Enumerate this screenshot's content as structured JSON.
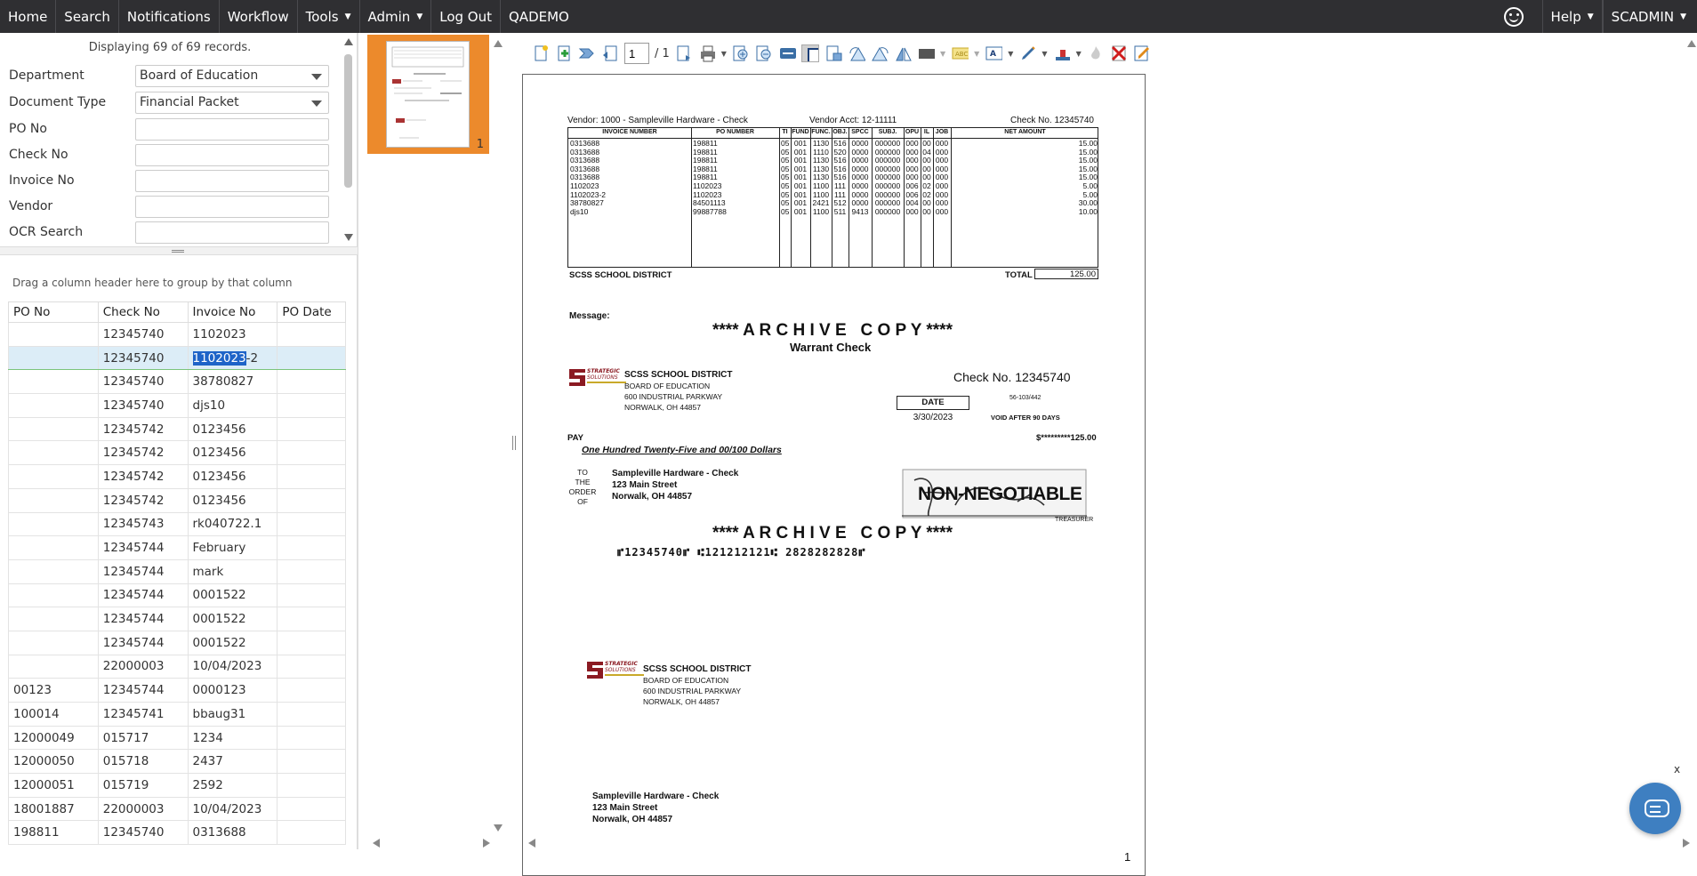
{
  "nav": {
    "items": [
      {
        "label": "Home",
        "caret": false
      },
      {
        "label": "Search",
        "caret": false
      },
      {
        "label": "Notifications",
        "caret": false
      },
      {
        "label": "Workflow",
        "caret": false
      },
      {
        "label": "Tools",
        "caret": true
      },
      {
        "label": "Admin",
        "caret": true
      },
      {
        "label": "Log Out",
        "caret": false
      },
      {
        "label": "QADEMO",
        "caret": false
      }
    ],
    "help": "Help",
    "user": "SCADMIN"
  },
  "search": {
    "displaying": "Displaying 69 of 69 records.",
    "department_label": "Department",
    "department_value": "Board of Education",
    "doctype_label": "Document Type",
    "doctype_value": "Financial Packet",
    "po_label": "PO No",
    "check_label": "Check No",
    "invoice_label": "Invoice No",
    "vendor_label": "Vendor",
    "ocr_label": "OCR Search"
  },
  "grid": {
    "group_hint": "Drag a column header here to group by that column",
    "columns": [
      "PO No",
      "Check No",
      "Invoice No",
      "PO Date"
    ],
    "rows": [
      [
        "",
        "12345740",
        "1102023",
        ""
      ],
      [
        "",
        "12345740",
        "1102023-2",
        ""
      ],
      [
        "",
        "12345740",
        "38780827",
        ""
      ],
      [
        "",
        "12345740",
        "djs10",
        ""
      ],
      [
        "",
        "12345742",
        "0123456",
        ""
      ],
      [
        "",
        "12345742",
        "0123456",
        ""
      ],
      [
        "",
        "12345742",
        "0123456",
        ""
      ],
      [
        "",
        "12345742",
        "0123456",
        ""
      ],
      [
        "",
        "12345743",
        "rk040722.1",
        ""
      ],
      [
        "",
        "12345744",
        "February",
        ""
      ],
      [
        "",
        "12345744",
        "mark",
        ""
      ],
      [
        "",
        "12345744",
        "0001522",
        ""
      ],
      [
        "",
        "12345744",
        "0001522",
        ""
      ],
      [
        "",
        "12345744",
        "0001522",
        ""
      ],
      [
        "",
        "22000003",
        "10/04/2023",
        ""
      ],
      [
        "00123",
        "12345744",
        "0000123",
        ""
      ],
      [
        "100014",
        "12345741",
        "bbaug31",
        ""
      ],
      [
        "12000049",
        "015717",
        "1234",
        ""
      ],
      [
        "12000050",
        "015718",
        "2437",
        ""
      ],
      [
        "12000051",
        "015719",
        "2592",
        ""
      ],
      [
        "18001887",
        "22000003",
        "10/04/2023",
        ""
      ],
      [
        "198811",
        "12345740",
        "0313688",
        ""
      ]
    ],
    "selected_row": 1,
    "selected_highlight": "1102023",
    "selected_rest": "-2"
  },
  "thumb": {
    "page_number": "1"
  },
  "viewer": {
    "page_input": "1",
    "page_total": "/ 1",
    "page_footer": "1"
  },
  "doc": {
    "vendor_line": "Vendor:  1000 - Sampleville Hardware - Check",
    "vendor_acct": "Vendor Acct:  12-11111",
    "check_no_top": "Check No.  12345740",
    "headers": [
      "INVOICE NUMBER",
      "PO NUMBER",
      "TI",
      "FUND",
      "FUNC.",
      "OBJ.",
      "SPCC",
      "SUBJ.",
      "OPU",
      "IL",
      "JOB",
      "NET AMOUNT"
    ],
    "lines": [
      [
        "0313688",
        "198811",
        "05",
        "001",
        "1130",
        "516",
        "0000",
        "000000",
        "000",
        "00",
        "000",
        "15.00"
      ],
      [
        "0313688",
        "198811",
        "05",
        "001",
        "1110",
        "520",
        "0000",
        "000000",
        "000",
        "04",
        "000",
        "15.00"
      ],
      [
        "0313688",
        "198811",
        "05",
        "001",
        "1130",
        "516",
        "0000",
        "000000",
        "000",
        "00",
        "000",
        "15.00"
      ],
      [
        "0313688",
        "198811",
        "05",
        "001",
        "1130",
        "516",
        "0000",
        "000000",
        "000",
        "00",
        "000",
        "15.00"
      ],
      [
        "0313688",
        "198811",
        "05",
        "001",
        "1130",
        "516",
        "0000",
        "000000",
        "000",
        "00",
        "000",
        "15.00"
      ],
      [
        "1102023",
        "1102023",
        "05",
        "001",
        "1100",
        "111",
        "0000",
        "000000",
        "006",
        "02",
        "000",
        "5.00"
      ],
      [
        "1102023-2",
        "1102023",
        "05",
        "001",
        "1100",
        "111",
        "0000",
        "000000",
        "006",
        "02",
        "000",
        "5.00"
      ],
      [
        "38780827",
        "84501113",
        "05",
        "001",
        "2421",
        "512",
        "0000",
        "000000",
        "004",
        "00",
        "000",
        "30.00"
      ],
      [
        "djs10",
        "99887788",
        "05",
        "001",
        "1100",
        "511",
        "9413",
        "000000",
        "000",
        "00",
        "000",
        "10.00"
      ]
    ],
    "district_footer": "SCSS SCHOOL DISTRICT",
    "total_label": "TOTAL",
    "total_value": "125.00",
    "message_label": "Message:",
    "archive_copy": "**** A R C H I V E   C O P Y ****",
    "warrant": "Warrant Check",
    "logo_text": "STRATEGIC SOLUTIONS",
    "district": "SCSS SCHOOL DISTRICT",
    "board": "BOARD OF EDUCATION",
    "addr1": "600 INDUSTRIAL PARKWAY",
    "addr2": "NORWALK, OH  44857",
    "check_no_big": "Check No. 12345740",
    "date_label": "DATE",
    "routing": "56-103/442",
    "date_value": "3/30/2023",
    "void_text": "VOID AFTER 90 DAYS",
    "pay_label": "PAY",
    "amount_stars": "$*********125.00",
    "amount_words": "One Hundred Twenty-Five and 00/100 Dollars",
    "to_label": "TO\nTHE\nORDER\nOF",
    "payee_name": "Sampleville Hardware - Check",
    "payee_street": "123 Main Street",
    "payee_city": "Norwalk, OH 44857",
    "non_negotiable": "NON-NEGOTIABLE",
    "treasurer": "TREASURER",
    "micr": "⑈12345740⑈ ⑆121212121⑆ 2828282828⑈"
  },
  "colors": {
    "nav_bg": "#2f2f32",
    "thumb_accent": "#ec8a2c",
    "selection": "#dcedf7",
    "chat": "#3e7fc1"
  }
}
